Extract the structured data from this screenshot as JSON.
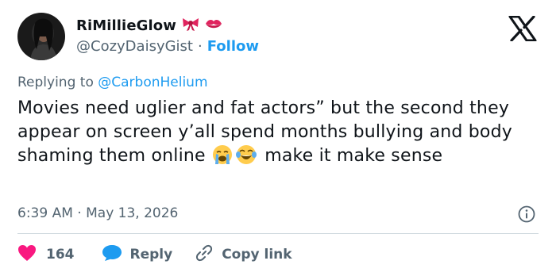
{
  "author": {
    "display_name": "RiMillieGlow",
    "handle": "@CozyDaisyGist",
    "separator": "·",
    "follow_label": "Follow"
  },
  "icons": {
    "avatar": "avatar-photo",
    "name_emojis": [
      "ribbon-icon",
      "kiss-mark-icon"
    ],
    "platform_logo": "x-logo-icon",
    "info": "info-icon",
    "like": "heart-icon",
    "reply": "speech-bubble-icon",
    "copy": "link-icon"
  },
  "reply_context": {
    "prefix": "Replying to",
    "handle": "@CarbonHelium"
  },
  "tweet": {
    "text_before": "Movies need uglier and fat actors” but the second they appear on screen y’all spend months bullying and body shaming them online",
    "text_after": "make it make sense",
    "emojis": [
      "loudly-crying-face",
      "face-with-tears-of-joy"
    ]
  },
  "meta": {
    "time": "6:39 AM",
    "separator": "·",
    "date": "May 13, 2026"
  },
  "actions": {
    "like_count": "164",
    "reply_label": "Reply",
    "copy_label": "Copy link"
  },
  "colors": {
    "accent": "#1d9bf0",
    "text": "#0f1419",
    "muted": "#536471",
    "like": "#f91880",
    "divider": "#cfd9de"
  }
}
